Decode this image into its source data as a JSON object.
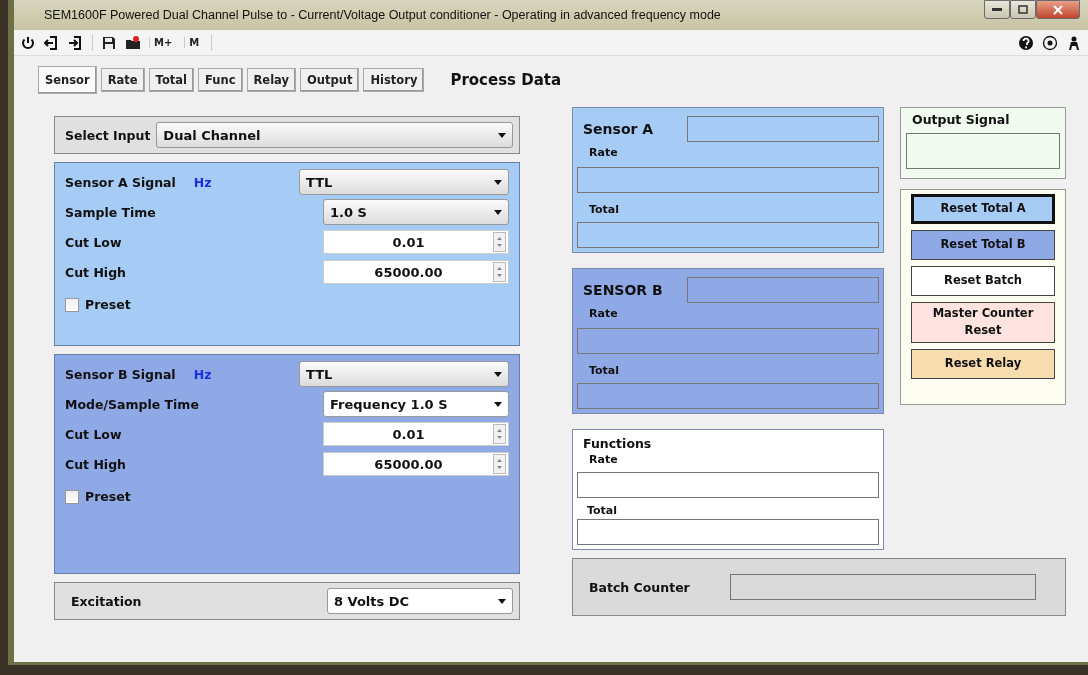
{
  "window": {
    "title": "SEM1600F  Powered  Dual Channel Pulse to - Current/Voltage Output conditioner - Operating in advanced frequency mode"
  },
  "toolbar_labels": [
    "M+",
    "M"
  ],
  "tabs": [
    {
      "label": "Sensor",
      "selected": true
    },
    {
      "label": "Rate",
      "selected": false
    },
    {
      "label": "Total",
      "selected": false
    },
    {
      "label": "Func",
      "selected": false
    },
    {
      "label": "Relay",
      "selected": false
    },
    {
      "label": "Output",
      "selected": false
    },
    {
      "label": "History",
      "selected": false
    }
  ],
  "heading": "Process Data",
  "select_input": {
    "label": "Select Input",
    "value": "Dual Channel"
  },
  "sensors": [
    {
      "label": "Sensor A Signal",
      "unit": "Hz",
      "signal": "TTL",
      "color": "#a6cbf5",
      "rows": [
        {
          "kind": "dropdown",
          "label": "Sample Time",
          "value": "1.0  S"
        },
        {
          "kind": "spin",
          "label": "Cut Low",
          "value": "0.01"
        },
        {
          "kind": "spin",
          "label": "Cut High",
          "value": "65000.00"
        }
      ],
      "preset": {
        "label": "Preset",
        "checked": false
      }
    },
    {
      "label": "Sensor B Signal",
      "unit": "Hz",
      "signal": "TTL",
      "color": "#8fa8e6",
      "rows": [
        {
          "kind": "dropdown",
          "label": "Mode/Sample Time",
          "value": "Frequency 1.0  S"
        },
        {
          "kind": "spin",
          "label": "Cut Low",
          "value": "0.01"
        },
        {
          "kind": "spin",
          "label": "Cut High",
          "value": "65000.00"
        }
      ],
      "preset": {
        "label": "Preset",
        "checked": false
      }
    }
  ],
  "excitation": {
    "label": "Excitation",
    "value": "8   Volts DC"
  },
  "process_panels": [
    {
      "title": "Sensor A",
      "rate_label": "Rate",
      "total_label": "Total",
      "color": "#a6cbf5"
    },
    {
      "title": "SENSOR B",
      "rate_label": "Rate",
      "total_label": "Total",
      "color": "#8fa8e6"
    }
  ],
  "functions": {
    "title": "Functions",
    "rate_label": "Rate",
    "total_label": "Total"
  },
  "output_signal": {
    "title": "Output Signal"
  },
  "reset_buttons": [
    {
      "label": "Reset Total A",
      "color": "#a6cbf5",
      "focused": true
    },
    {
      "label": "Reset Total B",
      "color": "#8fa8e6",
      "focused": false
    },
    {
      "label": "Reset Batch",
      "color": "#ffffff",
      "focused": false
    },
    {
      "label": "Master Counter Reset",
      "color": "#fde3df",
      "focused": false
    },
    {
      "label": "Reset   Relay",
      "color": "#f6dcae",
      "focused": false
    }
  ],
  "batch_counter": {
    "label": "Batch Counter"
  }
}
